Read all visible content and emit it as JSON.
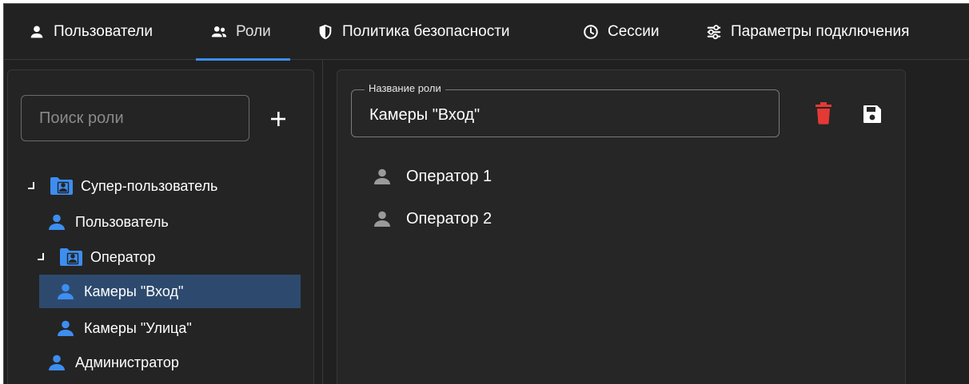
{
  "tabs": [
    {
      "label": "Пользователи",
      "icon": "user-icon",
      "active": false
    },
    {
      "label": "Роли",
      "icon": "users-group-icon",
      "active": true
    },
    {
      "label": "Политика безопасности",
      "icon": "shield-icon",
      "active": false
    },
    {
      "label": "Сессии",
      "icon": "clock-icon",
      "active": false
    },
    {
      "label": "Параметры подключения",
      "icon": "sliders-icon",
      "active": false
    }
  ],
  "search": {
    "placeholder": "Поиск роли",
    "value": ""
  },
  "tree": [
    {
      "label": "Супер-пользователь",
      "type": "folder",
      "expanded": true,
      "selected": false
    },
    {
      "label": "Пользователь",
      "type": "user",
      "selected": false
    },
    {
      "label": "Оператор",
      "type": "folder",
      "expanded": true,
      "selected": false
    },
    {
      "label": "Камеры \"Вход\"",
      "type": "user",
      "selected": true
    },
    {
      "label": "Камеры \"Улица\"",
      "type": "user",
      "selected": false
    },
    {
      "label": "Администратор",
      "type": "user",
      "selected": false
    }
  ],
  "role_editor": {
    "field_label": "Название роли",
    "field_value": "Камеры \"Вход\"",
    "members": [
      "Оператор 1",
      "Оператор 2"
    ]
  },
  "colors": {
    "accent": "#3d8ef0",
    "delete": "#e53935",
    "selected_bg": "#2d4a6e",
    "background": "#202020"
  }
}
